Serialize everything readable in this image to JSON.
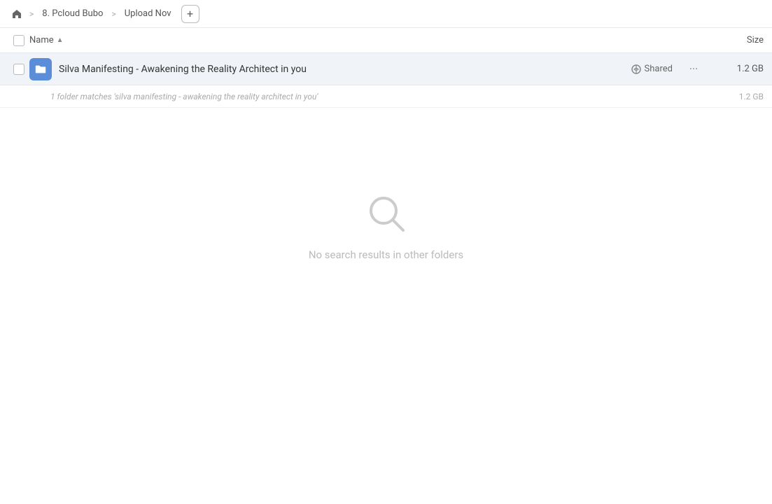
{
  "breadcrumb": {
    "home_icon": "🏠",
    "items": [
      {
        "label": "8. Pcloud Bubo"
      },
      {
        "label": "Upload Nov"
      }
    ],
    "add_button_label": "+"
  },
  "column_header": {
    "name_label": "Name",
    "sort_arrow": "▲",
    "size_label": "Size"
  },
  "file_row": {
    "name": "Silva Manifesting - Awakening the Reality Architect in you",
    "shared_label": "Shared",
    "more_label": "···",
    "size": "1.2 GB"
  },
  "match_info": {
    "text": "1 folder matches 'silva manifesting - awakening the reality architect in you'",
    "size": "1.2 GB"
  },
  "empty_state": {
    "text": "No search results in other folders"
  }
}
